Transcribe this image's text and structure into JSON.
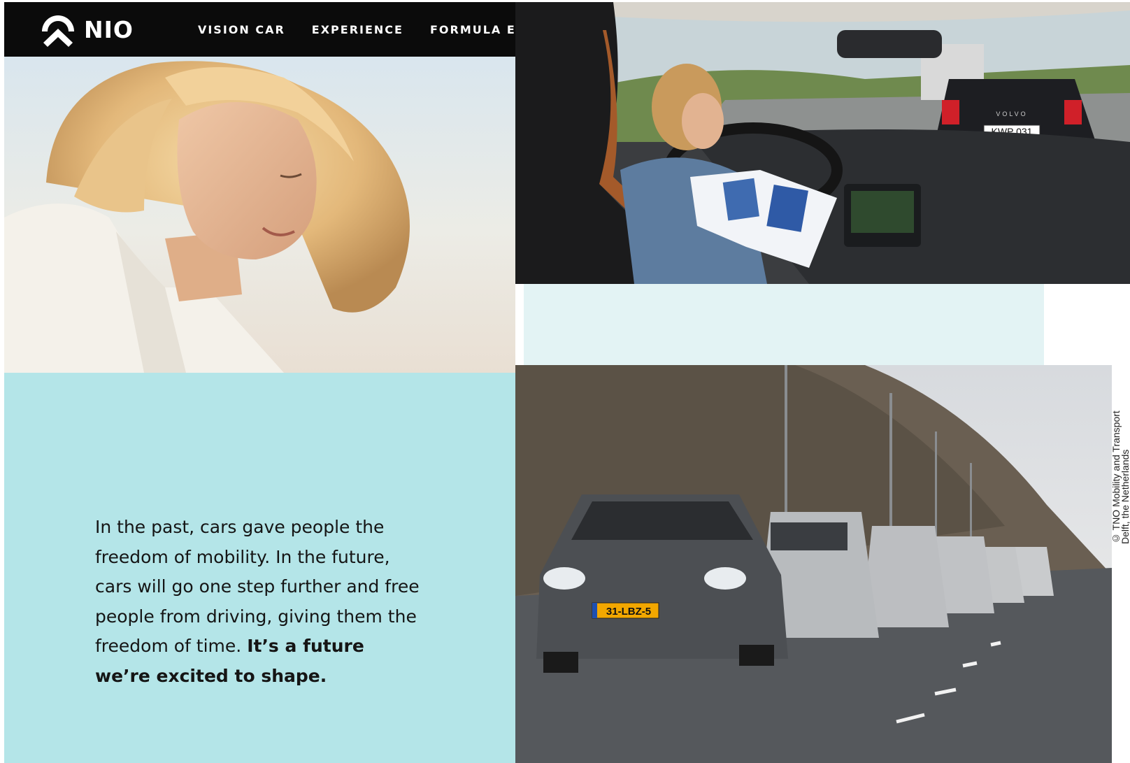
{
  "nav": {
    "brand": "NIO",
    "links": [
      {
        "label": "VISION CAR"
      },
      {
        "label": "EXPERIENCE"
      },
      {
        "label": "FORMULA E"
      }
    ]
  },
  "hero_text": {
    "regular": "In the past, cars gave people the freedom of mobility. In the future, cars will go one step further and free people from driving, giving them the freedom of time. ",
    "bold": "It’s a future we’re excited to shape."
  },
  "photo_top": {
    "license_plate": "KWP 031",
    "brand_text": "VOLVO"
  },
  "photo_bottom": {
    "license_plate": "31-LBZ-5"
  },
  "credit": {
    "line1": "© TNO Mobility and Transport",
    "line2": "Delft, the Netherlands"
  },
  "colors": {
    "nav_bg": "#0b0b0b",
    "text_block_bg": "#b4e5e8",
    "band_bg": "#e3f3f4"
  }
}
